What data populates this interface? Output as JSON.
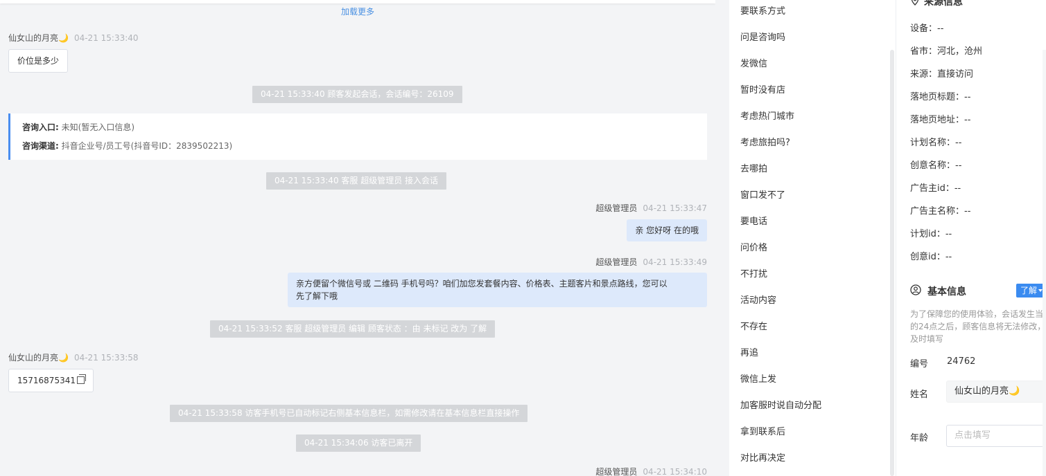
{
  "chat": {
    "load_more": "加载更多",
    "messages": [
      {
        "sender": "仙女山的月亮🌙",
        "time": "04-21 15:33:40",
        "text": "价位是多少"
      },
      {
        "system": "04-21 15:33:40 顾客发起会话，会话编号：26109"
      },
      {
        "system": "04-21 15:33:40 客服 超级管理员 接入会话"
      },
      {
        "sender": "超级管理员",
        "time": "04-21 15:33:47",
        "text": "亲 您好呀 在的哦"
      },
      {
        "sender": "超级管理员",
        "time": "04-21 15:33:49",
        "text_line1": "亲方便留个微信号或 二维码 手机号吗？咱们加您发套餐内容、价格表、主题客片和景点路线，您可以",
        "text_line2": "先了解下哦"
      },
      {
        "system": "04-21 15:33:52 客服 超级管理员 编辑 顾客状态 ：由 未标记 改为 了解"
      },
      {
        "sender": "仙女山的月亮🌙",
        "time": "04-21 15:33:58",
        "text": "15716875341"
      },
      {
        "system": "04-21 15:33:58 访客手机号已自动标记右侧基本信息栏，如需修改请在基本信息栏直接操作"
      },
      {
        "system": "04-21 15:34:06 访客已离开"
      },
      {
        "sender": "超级管理员",
        "time": "04-21 15:34:10"
      }
    ],
    "consult_card": {
      "entry_label": "咨询入口:",
      "entry_value": "未知(暂无入口信息)",
      "channel_label": "咨询渠道:",
      "channel_value": "抖音企业号/员工号(抖音号ID：2839502213)"
    }
  },
  "quick_replies": [
    "要联系方式",
    "问是咨询吗",
    "发微信",
    "暂时没有店",
    "考虑热门城市",
    "考虑旅拍吗?",
    "去哪拍",
    "窗口发不了",
    "要电话",
    "问价格",
    "不打扰",
    "活动内容",
    "不存在",
    "再追",
    "微信上发",
    "加客服时说自动分配",
    "拿到联系后",
    "对比再决定"
  ],
  "source_info": {
    "title": "来源信息",
    "rows": [
      "设备：--",
      "省市：河北，沧州",
      "来源：直接访问",
      "落地页标题：--",
      "落地页地址：--",
      "计划名称：--",
      "创意名称：--",
      "广告主id：--",
      "广告主名称：--",
      "计划id：--",
      "创意id：--"
    ]
  },
  "basic_info": {
    "title": "基本信息",
    "status_tag": "了解",
    "hint_lines": [
      "为了保障您的使用体验，会话发生当日",
      "的24点之后，顾客信息将无法修改，请",
      "及时填写"
    ],
    "id_label": "编号",
    "id_value": "24762",
    "name_label": "姓名",
    "name_value": "仙女山的月亮🌙",
    "age_label": "年龄",
    "age_placeholder": "点击填写"
  },
  "colors": {
    "accent": "#3a8bf0",
    "agent_bubble": "#dde9fb",
    "system_pill": "#d4d6d9",
    "link": "#4a90e2"
  }
}
